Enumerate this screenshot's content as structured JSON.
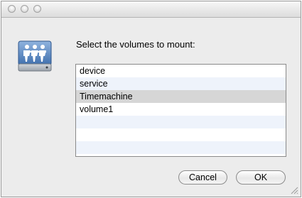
{
  "window": {
    "title": ""
  },
  "dialog": {
    "prompt": "Select the volumes to mount:",
    "icon": "network-share-icon",
    "volumes": [
      {
        "label": "device",
        "selected": false
      },
      {
        "label": "service",
        "selected": false
      },
      {
        "label": "Timemachine",
        "selected": true
      },
      {
        "label": "volume1",
        "selected": false
      }
    ],
    "cancel_label": "Cancel",
    "ok_label": "OK"
  },
  "colors": {
    "selection": "#d6d6d6",
    "alt_row": "#eef3fb",
    "window_bg": "#ececec"
  }
}
